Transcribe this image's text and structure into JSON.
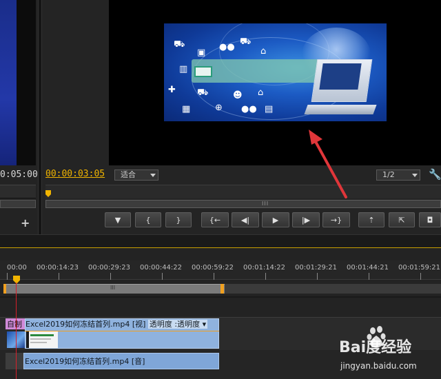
{
  "source_monitor": {
    "timecode": "0:05:00",
    "add_button": "+"
  },
  "program_monitor": {
    "timecode": "00:00:03:05",
    "fit_select": "适合",
    "resolution_select": "1/2",
    "scroll_grip": "III",
    "transport_buttons": [
      {
        "name": "add-marker-button",
        "glyph": "▼"
      },
      {
        "name": "mark-in-button",
        "glyph": "{"
      },
      {
        "name": "mark-out-button",
        "glyph": "}"
      },
      {
        "name": "go-to-in-button",
        "glyph": "{←"
      },
      {
        "name": "step-back-button",
        "glyph": "◀|"
      },
      {
        "name": "play-button",
        "glyph": "▶"
      },
      {
        "name": "step-forward-button",
        "glyph": "|▶"
      },
      {
        "name": "go-to-out-button",
        "glyph": "→}"
      },
      {
        "name": "lift-button",
        "glyph": "⇡"
      },
      {
        "name": "extract-button",
        "glyph": "⇱"
      },
      {
        "name": "export-frame-button",
        "glyph": "◘"
      }
    ]
  },
  "timeline": {
    "ruler_ticks": [
      "00:00",
      "00:00:14:23",
      "00:00:29:23",
      "00:00:44:22",
      "00:00:59:22",
      "00:01:14:22",
      "00:01:29:21",
      "00:01:44:21",
      "00:01:59:21"
    ],
    "work_area_grip": "III",
    "video_track": {
      "fx_label": "自制",
      "clip_label": "Excel2019如何冻结首列.mp4 [视]",
      "effect_label": "透明度 :透明度 ▾"
    },
    "audio_track": {
      "clip_label": "Excel2019如何冻结首列.mp4 [音]"
    }
  },
  "watermark": {
    "brand": "Bai度经验",
    "url": "jingyan.baidu.com"
  },
  "colors": {
    "accent_timecode": "#f0b400",
    "playhead": "#d8202a",
    "video_clip": "#8fb2de",
    "fx_clip": "#d08ad8",
    "arrow": "#e0363a"
  }
}
